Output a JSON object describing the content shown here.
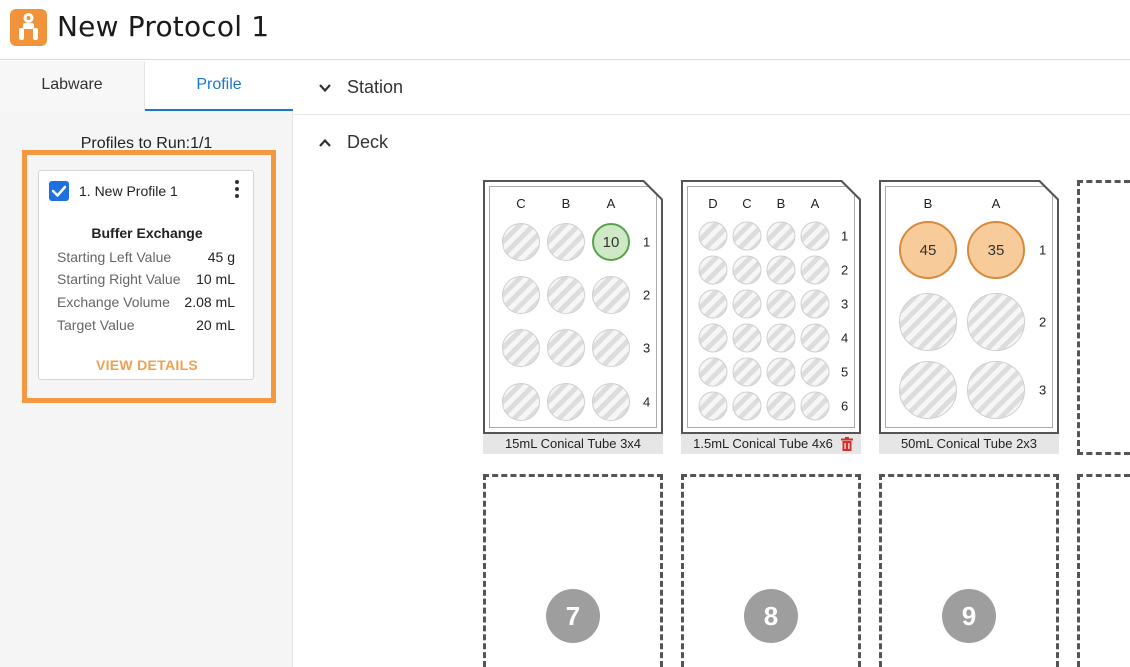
{
  "app": {
    "title": "New Protocol 1",
    "icon": "lab-robot-icon",
    "accent": "#f0933a"
  },
  "tabs": [
    {
      "label": "Labware"
    },
    {
      "label": "Profile",
      "active": true
    }
  ],
  "profiles_summary": "Profiles to Run:1/1",
  "profile_card": {
    "name": "1. New Profile 1",
    "checked": true,
    "type": "Buffer Exchange",
    "fields": [
      {
        "key": "Starting Left Value",
        "value": "45 g"
      },
      {
        "key": "Starting Right Value",
        "value": "10 mL"
      },
      {
        "key": "Exchange Volume",
        "value": "2.08 mL"
      },
      {
        "key": "Target Value",
        "value": "20 mL"
      }
    ],
    "action": "VIEW DETAILS"
  },
  "sections": {
    "station": "Station",
    "deck": "Deck"
  },
  "labware": [
    {
      "name": "15mL Conical Tube 3x4",
      "cols": [
        "C",
        "B",
        "A"
      ],
      "rows": [
        "1",
        "2",
        "3",
        "4"
      ],
      "filled": [
        {
          "col": "A",
          "row": "1",
          "value": "10",
          "color": "green"
        }
      ]
    },
    {
      "name": "1.5mL Conical Tube 4x6",
      "cols": [
        "D",
        "C",
        "B",
        "A"
      ],
      "rows": [
        "1",
        "2",
        "3",
        "4",
        "5",
        "6"
      ],
      "filled": []
    },
    {
      "name": "50mL Conical Tube 2x3",
      "cols": [
        "B",
        "A"
      ],
      "rows": [
        "1",
        "2",
        "3"
      ],
      "filled": [
        {
          "col": "B",
          "row": "1",
          "value": "45",
          "color": "orange"
        },
        {
          "col": "A",
          "row": "1",
          "value": "35",
          "color": "orange"
        }
      ]
    }
  ],
  "empty_slots": [
    "7",
    "8",
    "9"
  ],
  "colors": {
    "tab_active": "#1976d2",
    "highlight": "#f39740",
    "well_green": "#59a24c",
    "well_orange": "#d8893c",
    "trash": "#d32f2f"
  }
}
